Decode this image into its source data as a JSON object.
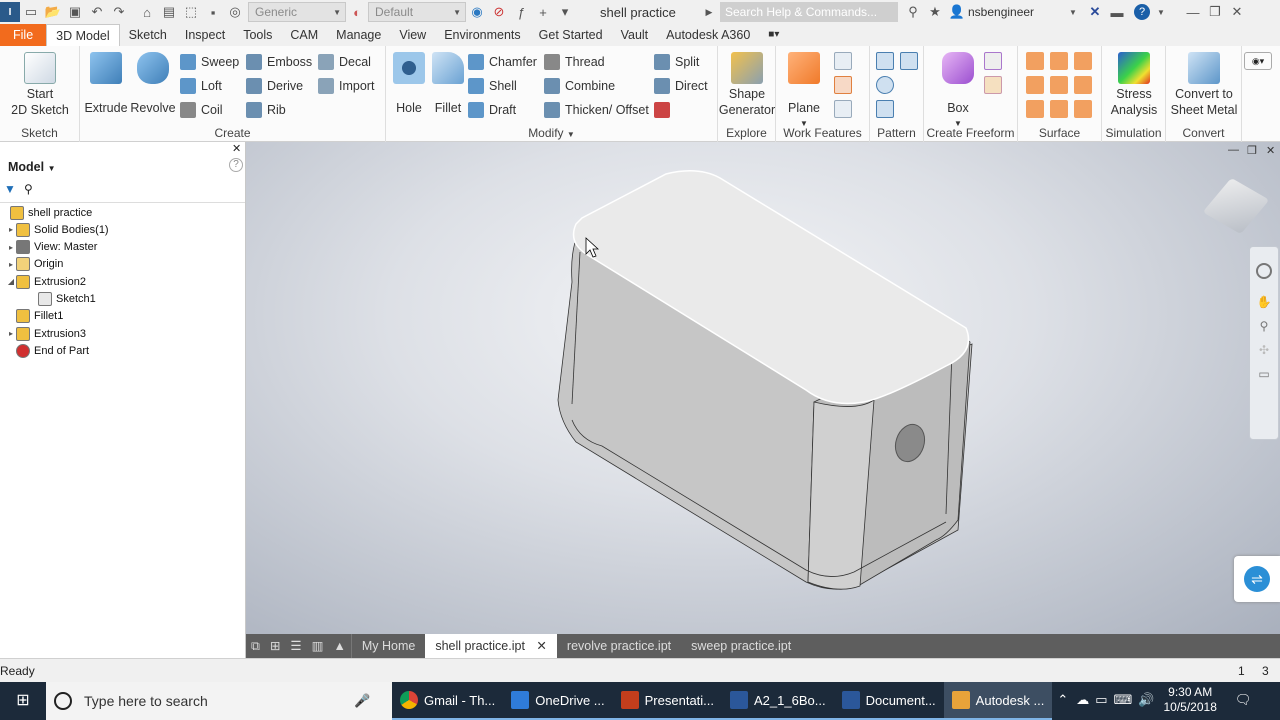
{
  "title_bar": {
    "material": "Generic",
    "appearance": "Default",
    "document_title": "shell practice",
    "search_placeholder": "Search Help & Commands...",
    "user": "nsbengineer"
  },
  "tabs": [
    "File",
    "3D Model",
    "Sketch",
    "Inspect",
    "Tools",
    "CAM",
    "Manage",
    "View",
    "Environments",
    "Get Started",
    "Vault",
    "Autodesk A360"
  ],
  "active_tab": "3D Model",
  "ribbon": {
    "sketch": {
      "title": "Sketch",
      "start_line1": "Start",
      "start_line2": "2D Sketch"
    },
    "create": {
      "title": "Create",
      "extrude": "Extrude",
      "revolve": "Revolve",
      "sweep": "Sweep",
      "loft": "Loft",
      "coil": "Coil",
      "emboss": "Emboss",
      "derive": "Derive",
      "rib": "Rib",
      "decal": "Decal",
      "import": "Import"
    },
    "modify": {
      "title": "Modify",
      "hole": "Hole",
      "fillet": "Fillet",
      "chamfer": "Chamfer",
      "shell": "Shell",
      "draft": "Draft",
      "thread": "Thread",
      "combine": "Combine",
      "thicken": "Thicken/ Offset",
      "split": "Split",
      "direct": "Direct"
    },
    "explore": {
      "title": "Explore",
      "shape_line1": "Shape",
      "shape_line2": "Generator"
    },
    "work_features": {
      "title": "Work Features",
      "plane": "Plane"
    },
    "pattern": {
      "title": "Pattern"
    },
    "freeform": {
      "title": "Create Freeform",
      "box": "Box"
    },
    "surface": {
      "title": "Surface"
    },
    "simulation": {
      "title": "Simulation",
      "stress_line1": "Stress",
      "stress_line2": "Analysis"
    },
    "convert": {
      "title": "Convert",
      "line1": "Convert to",
      "line2": "Sheet Metal"
    }
  },
  "browser": {
    "header": "Model",
    "items": [
      {
        "label": "shell practice",
        "level": 0,
        "expander": "",
        "icon": "part-icon"
      },
      {
        "label": "Solid Bodies(1)",
        "level": 1,
        "expander": "▸",
        "icon": "solid-bodies-icon"
      },
      {
        "label": "View: Master",
        "level": 1,
        "expander": "▸",
        "icon": "view-icon"
      },
      {
        "label": "Origin",
        "level": 1,
        "expander": "▸",
        "icon": "folder-icon"
      },
      {
        "label": "Extrusion2",
        "level": 1,
        "expander": "◢",
        "icon": "extrusion-icon"
      },
      {
        "label": "Sketch1",
        "level": 2,
        "expander": "",
        "icon": "sketch-icon"
      },
      {
        "label": "Fillet1",
        "level": 1,
        "expander": "",
        "icon": "fillet-icon"
      },
      {
        "label": "Extrusion3",
        "level": 1,
        "expander": "▸",
        "icon": "extrusion-icon"
      },
      {
        "label": "End of Part",
        "level": 1,
        "expander": "",
        "icon": "end-of-part-icon"
      }
    ]
  },
  "doc_tabs": {
    "home": "My Home",
    "tabs": [
      {
        "label": "shell practice.ipt",
        "active": true
      },
      {
        "label": "revolve practice.ipt",
        "active": false
      },
      {
        "label": "sweep practice.ipt",
        "active": false
      }
    ]
  },
  "status": {
    "text": "Ready",
    "count1": "1",
    "count2": "3"
  },
  "taskbar": {
    "search_placeholder": "Type here to search",
    "apps": [
      {
        "label": "Gmail - Th...",
        "icon": "chrome-icon",
        "state": "open"
      },
      {
        "label": "OneDrive ...",
        "icon": "onedrive-icon",
        "state": "open"
      },
      {
        "label": "Presentati...",
        "icon": "powerpoint-icon",
        "state": "open"
      },
      {
        "label": "A2_1_6Bo...",
        "icon": "word-icon",
        "state": "open"
      },
      {
        "label": "Document...",
        "icon": "word-icon",
        "state": "open"
      },
      {
        "label": "Autodesk ...",
        "icon": "inventor-icon",
        "state": "active"
      }
    ],
    "time": "9:30 AM",
    "date": "10/5/2018"
  },
  "colors": {
    "file_tab": "#f26b1d",
    "taskbar": "#1c2a3a",
    "viewport_center": "#f4f5f7",
    "viewport_edge": "#a9b0bd",
    "model_face": "#c9c9c9"
  }
}
